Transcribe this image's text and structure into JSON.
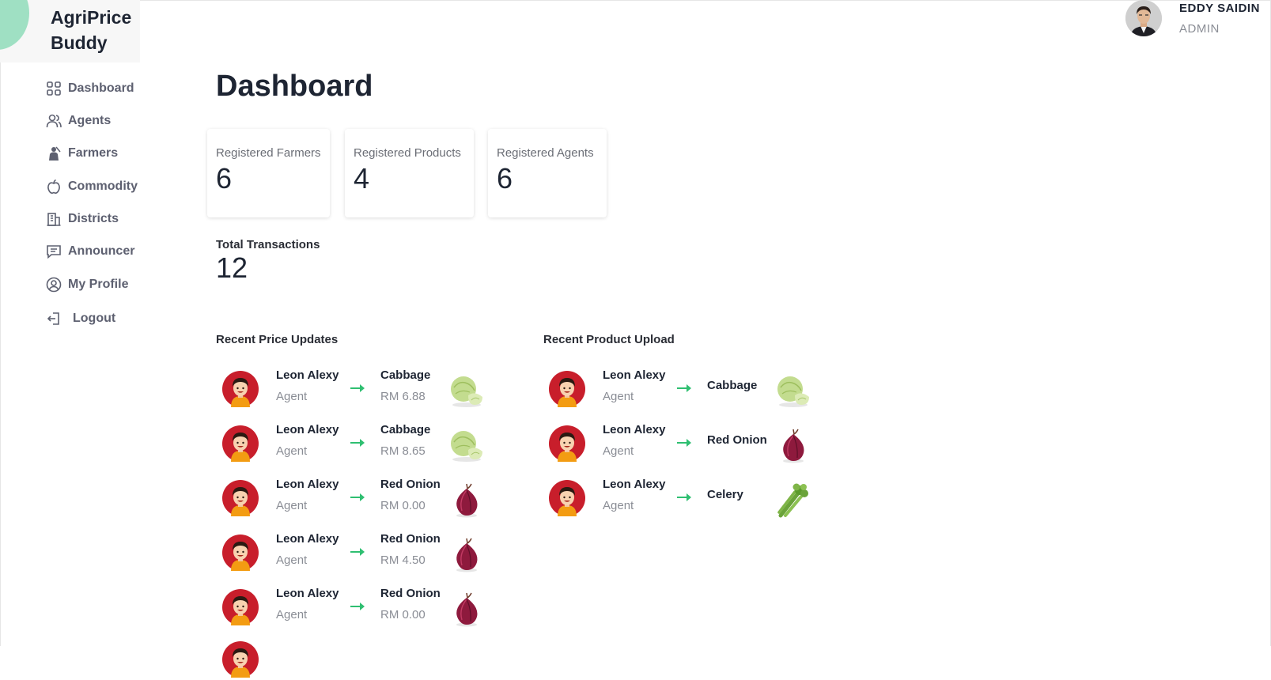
{
  "app": {
    "name": "AgriPrice Buddy"
  },
  "user": {
    "name": "EDDY SAIDIN",
    "role": "ADMIN"
  },
  "sidebar": {
    "items": [
      {
        "label": "Dashboard",
        "icon": "grid-icon"
      },
      {
        "label": "Agents",
        "icon": "users-icon"
      },
      {
        "label": "Farmers",
        "icon": "farmer-icon"
      },
      {
        "label": "Commodity",
        "icon": "apple-icon"
      },
      {
        "label": "Districts",
        "icon": "building-icon"
      },
      {
        "label": "Announcer",
        "icon": "message-icon"
      },
      {
        "label": "My Profile",
        "icon": "user-circle-icon"
      },
      {
        "label": "Logout",
        "icon": "logout-icon"
      }
    ]
  },
  "page": {
    "title": "Dashboard"
  },
  "stats": {
    "farmers": {
      "label": "Registered Farmers",
      "value": "6"
    },
    "products": {
      "label": "Registered Products",
      "value": "4"
    },
    "agents": {
      "label": "Registered Agents",
      "value": "6"
    },
    "transactions": {
      "label": "Total Transactions",
      "value": "12"
    }
  },
  "price_updates": {
    "title": "Recent Price Updates",
    "rows": [
      {
        "name": "Leon Alexy",
        "role": "Agent",
        "product": "Cabbage",
        "price": "RM 6.88",
        "image": "cabbage"
      },
      {
        "name": "Leon Alexy",
        "role": "Agent",
        "product": "Cabbage",
        "price": "RM 8.65",
        "image": "cabbage"
      },
      {
        "name": "Leon Alexy",
        "role": "Agent",
        "product": "Red Onion",
        "price": "RM 0.00",
        "image": "red-onion"
      },
      {
        "name": "Leon Alexy",
        "role": "Agent",
        "product": "Red Onion",
        "price": "RM 4.50",
        "image": "red-onion"
      },
      {
        "name": "Leon Alexy",
        "role": "Agent",
        "product": "Red Onion",
        "price": "RM 0.00",
        "image": "red-onion"
      }
    ]
  },
  "product_uploads": {
    "title": "Recent Product Upload",
    "rows": [
      {
        "name": "Leon Alexy",
        "role": "Agent",
        "product": "Cabbage",
        "image": "cabbage"
      },
      {
        "name": "Leon Alexy",
        "role": "Agent",
        "product": "Red Onion",
        "image": "red-onion"
      },
      {
        "name": "Leon Alexy",
        "role": "Agent",
        "product": "Celery",
        "image": "celery"
      }
    ]
  },
  "colors": {
    "accent_green": "#2fbf71",
    "avatar_red": "#c81e2b",
    "logo_mint": "#9fe0c3"
  }
}
